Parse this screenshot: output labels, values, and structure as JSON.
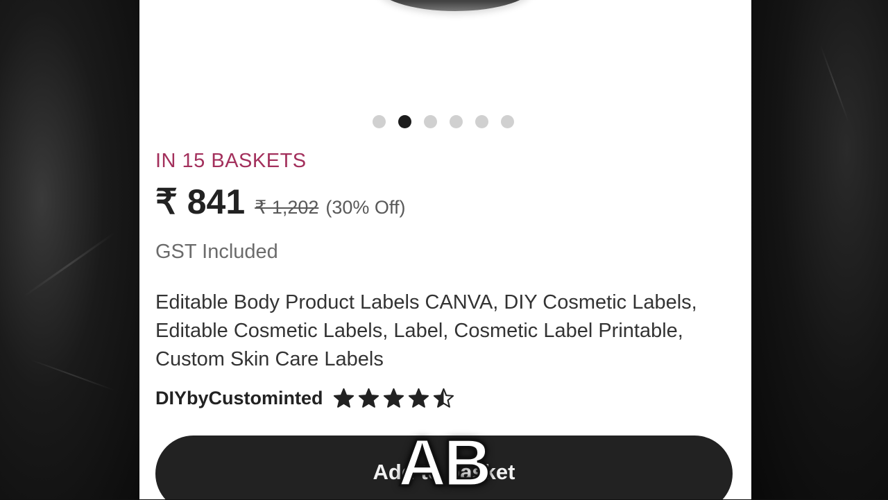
{
  "carousel": {
    "dot_count": 6,
    "active_index": 1
  },
  "product": {
    "baskets_text": "IN 15 BASKETS",
    "price": "₹ 841",
    "original_price": "₹ 1,202",
    "discount": "(30% Off)",
    "tax_note": "GST Included",
    "title": "Editable Body Product Labels CANVA, DIY Cosmetic Labels, Editable Cosmetic Labels, Label, Cosmetic Label Printable, Custom Skin Care Labels"
  },
  "shop": {
    "name": "DIYbyCustominted",
    "rating": 4.5,
    "rating_max": 5
  },
  "actions": {
    "add_to_basket_label": "Add to basket"
  },
  "overlay": {
    "caption": "AB"
  },
  "colors": {
    "baskets_accent": "#a3305c",
    "button_bg": "#222222",
    "star": "#222222"
  }
}
